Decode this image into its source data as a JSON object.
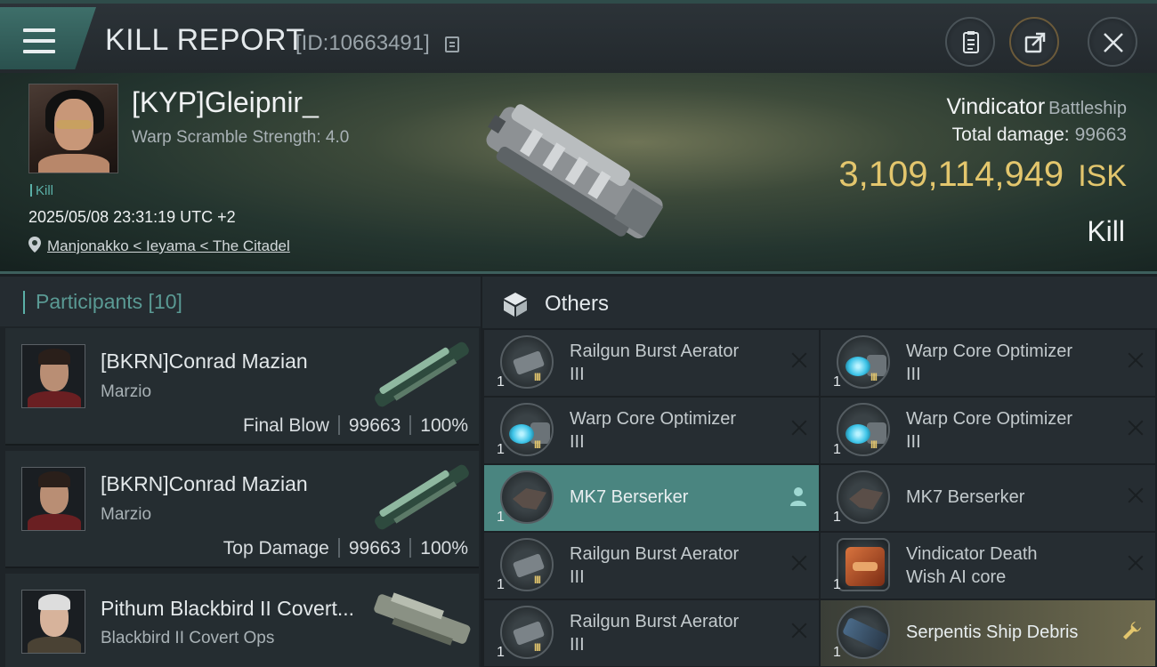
{
  "header": {
    "title": "KILL REPORT",
    "report_id": "[ID:10663491]",
    "icons": [
      "menu-icon",
      "copy-icon",
      "clipboard-icon",
      "share-icon",
      "close-icon"
    ]
  },
  "victim": {
    "name": "[KYP]Gleipnir_",
    "warp_scramble": "Warp Scramble Strength: 4.0",
    "tag": "Kill",
    "date": "2025/05/08 23:31:19 UTC +2",
    "location": "Manjonakko < Ieyama < The Citadel",
    "ship": "Vindicator",
    "ship_class": "Battleship",
    "total_damage_label": "Total damage:",
    "total_damage": "99663",
    "isk_value": "3,109,114,949",
    "isk_unit": "ISK",
    "result": "Kill"
  },
  "participants": {
    "title": "Participants [10]",
    "rows": [
      {
        "name": "[BKRN]Conrad Mazian",
        "corp": "Marzio",
        "role": "Final Blow",
        "damage": "99663",
        "percent": "100%"
      },
      {
        "name": "[BKRN]Conrad Mazian",
        "corp": "Marzio",
        "role": "Top Damage",
        "damage": "99663",
        "percent": "100%"
      },
      {
        "name": "Pithum Blackbird II Covert...",
        "corp": "Blackbird II Covert Ops"
      }
    ]
  },
  "others": {
    "title": "Others",
    "items": [
      {
        "qty": "1",
        "tier": "III",
        "line1": "Railgun Burst Aerator",
        "line2": "III",
        "icon": "railgun-icon"
      },
      {
        "qty": "1",
        "tier": "III",
        "line1": "Warp Core Optimizer",
        "line2": "III",
        "icon": "warp-core-icon"
      },
      {
        "qty": "1",
        "tier": "III",
        "line1": "Warp Core Optimizer",
        "line2": "III",
        "icon": "warp-core-icon"
      },
      {
        "qty": "1",
        "tier": "III",
        "line1": "Warp Core Optimizer",
        "line2": "III",
        "icon": "warp-core-icon"
      },
      {
        "qty": "1",
        "line1": "MK7  Berserker",
        "icon": "drone-icon"
      },
      {
        "qty": "1",
        "line1": "MK7  Berserker",
        "icon": "drone-icon"
      },
      {
        "qty": "1",
        "tier": "III",
        "line1": "Railgun Burst Aerator",
        "line2": "III",
        "icon": "railgun-icon"
      },
      {
        "qty": "1",
        "line1": "Vindicator Death",
        "line2": "Wish AI core",
        "icon": "ai-core-icon"
      },
      {
        "qty": "1",
        "tier": "III",
        "line1": "Railgun Burst Aerator",
        "line2": "III",
        "icon": "railgun-icon"
      },
      {
        "qty": "1",
        "line1": "Serpentis Ship Debris",
        "icon": "debris-icon"
      }
    ]
  },
  "colors": {
    "accent": "#5bb0a8",
    "isk_gold": "#e3c66d",
    "selected_row": "#4a8580"
  }
}
